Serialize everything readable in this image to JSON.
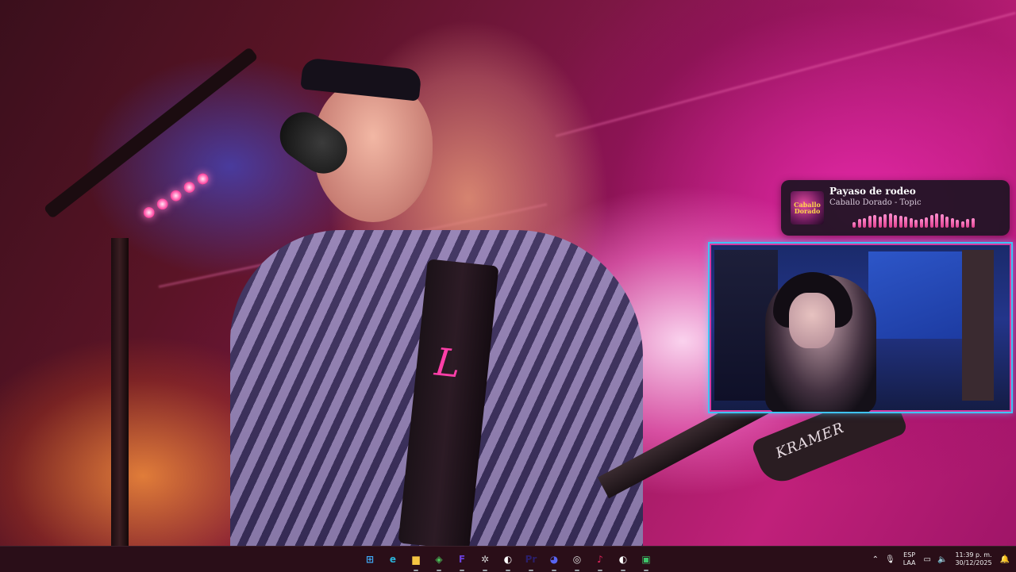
{
  "now_playing": {
    "title": "Payaso de rodeo",
    "artist": "Caballo Dorado - Topic",
    "album_art_text": "Caballo Dorado",
    "visualizer_levels": [
      0.35,
      0.55,
      0.6,
      0.75,
      0.8,
      0.7,
      0.85,
      0.9,
      0.8,
      0.75,
      0.7,
      0.6,
      0.5,
      0.55,
      0.65,
      0.8,
      0.9,
      0.85,
      0.7,
      0.6,
      0.5,
      0.4,
      0.55,
      0.6
    ]
  },
  "wallpaper": {
    "guitar_brand": "KRAMER",
    "strap_letter": "L"
  },
  "taskbar": {
    "apps": [
      {
        "name": "start-button",
        "icon": "windows-logo-icon",
        "color": "#3fa6f2"
      },
      {
        "name": "edge-button",
        "icon": "edge-icon",
        "color": "#2bb3d9"
      },
      {
        "name": "file-explorer-button",
        "icon": "folder-icon",
        "color": "#f5c542"
      },
      {
        "name": "browser-button",
        "icon": "shield-browser-icon",
        "color": "#4cc25a"
      },
      {
        "name": "app-f-button",
        "icon": "f-logo-icon",
        "color": "#6a3fd8"
      },
      {
        "name": "settings-app-button",
        "icon": "gear-icon",
        "color": "#d0d0d0"
      },
      {
        "name": "steam-button",
        "icon": "steam-icon",
        "color": "#ffffff"
      },
      {
        "name": "premiere-button",
        "icon": "premiere-icon",
        "color": "#2b1f6b"
      },
      {
        "name": "discord-button",
        "icon": "discord-icon",
        "color": "#5865f2"
      },
      {
        "name": "obs-button",
        "icon": "obs-icon",
        "color": "#e0e0e0"
      },
      {
        "name": "tiktok-button",
        "icon": "tiktok-icon",
        "color": "#e6245e"
      },
      {
        "name": "steam2-button",
        "icon": "steam-icon",
        "color": "#ffffff"
      },
      {
        "name": "app-green-button",
        "icon": "green-app-icon",
        "color": "#3ec46a"
      }
    ],
    "app_labels": [
      "⊞",
      "e",
      "▆",
      "◈",
      "F",
      "✲",
      "◐",
      "Pr",
      "◕",
      "◎",
      "♪",
      "◐",
      "▣"
    ],
    "lang_line1": "ESP",
    "lang_line2": "LAA",
    "time": "11:39 p. m.",
    "date": "30/12/2025"
  }
}
